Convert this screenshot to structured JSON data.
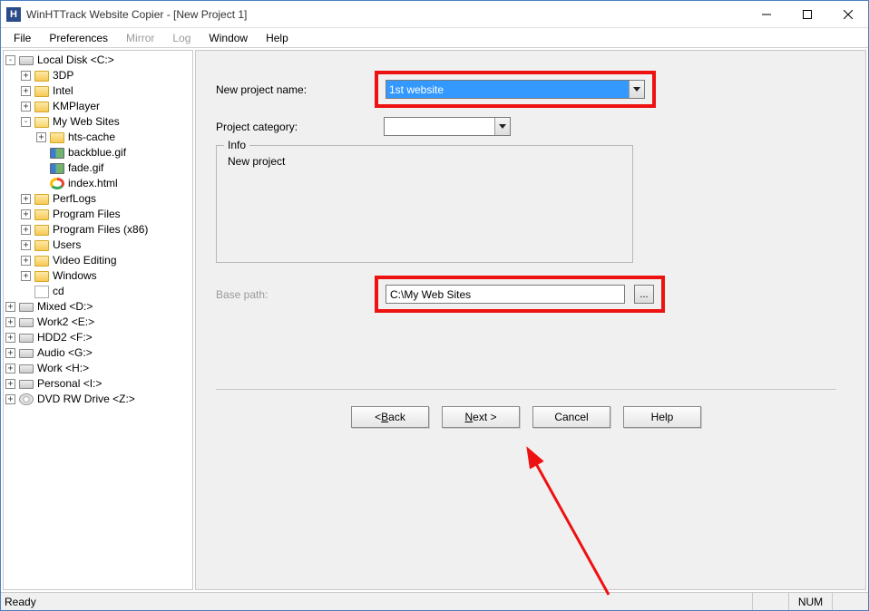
{
  "window": {
    "title": "WinHTTrack Website Copier - [New Project 1]",
    "app_icon_letter": "H"
  },
  "menubar": {
    "file": "File",
    "preferences": "Preferences",
    "mirror": "Mirror",
    "log": "Log",
    "window": "Window",
    "help": "Help"
  },
  "tree": {
    "root": "Local Disk <C:>",
    "items": [
      "3DP",
      "Intel",
      "KMPlayer"
    ],
    "mywebsites": {
      "label": "My Web Sites",
      "children": {
        "htscache": "hts-cache",
        "backblue": "backblue.gif",
        "fade": "fade.gif",
        "index": "index.html"
      }
    },
    "after": [
      "PerfLogs",
      "Program Files",
      "Program Files (x86)",
      "Users",
      "Video Editing",
      "Windows",
      "cd"
    ],
    "drives": [
      "Mixed <D:>",
      "Work2 <E:>",
      "HDD2 <F:>",
      "Audio <G:>",
      "Work <H:>",
      "Personal <I:>"
    ],
    "dvd": "DVD RW Drive <Z:>"
  },
  "form": {
    "project_name_label": "New project name:",
    "project_name_value": "1st website",
    "project_category_label": "Project category:",
    "project_category_value": "",
    "info_legend": "Info",
    "info_text": "New project",
    "base_path_label": "Base path:",
    "base_path_value": "C:\\My Web Sites",
    "browse_btn": "..."
  },
  "buttons": {
    "back": "< Back",
    "next": "Next >",
    "cancel": "Cancel",
    "help": "Help"
  },
  "statusbar": {
    "ready": "Ready",
    "num": "NUM"
  }
}
